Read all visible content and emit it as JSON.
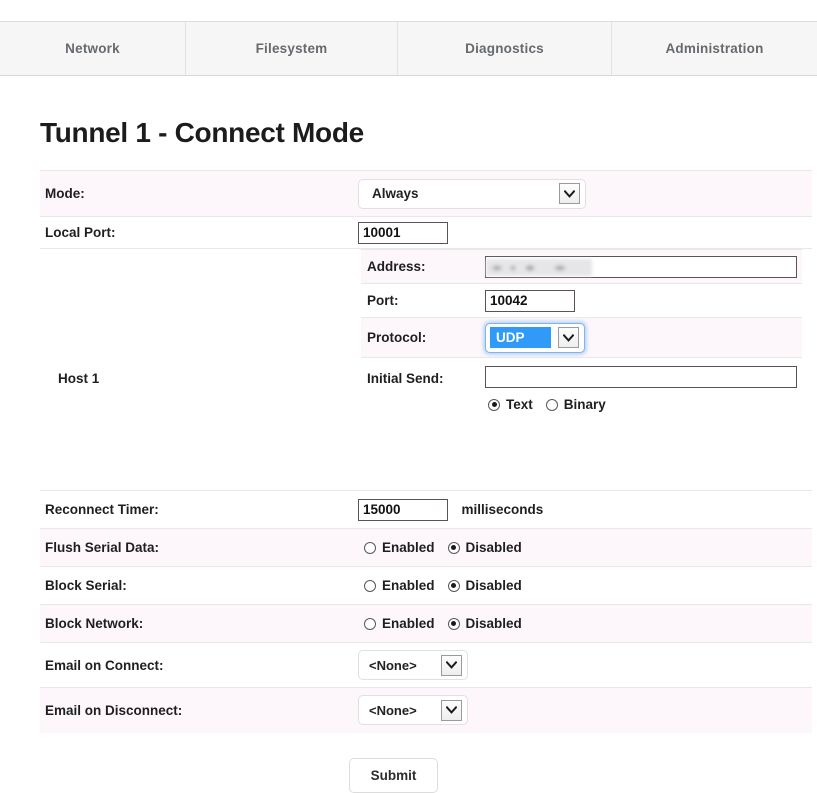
{
  "nav": {
    "tabs": [
      {
        "label": "Network"
      },
      {
        "label": "Filesystem"
      },
      {
        "label": "Diagnostics"
      },
      {
        "label": "Administration"
      }
    ]
  },
  "page": {
    "title": "Tunnel 1 - Connect Mode"
  },
  "form": {
    "mode": {
      "label": "Mode:",
      "value": "Always"
    },
    "local_port": {
      "label": "Local Port:",
      "value": "10001"
    },
    "host": {
      "label": "Host 1",
      "address": {
        "label": "Address:",
        "value": "",
        "redacted": true
      },
      "port": {
        "label": "Port:",
        "value": "10042"
      },
      "protocol": {
        "label": "Protocol:",
        "value": "UDP",
        "focused": true,
        "highlight_color": "#2f9af7",
        "focus_ring_color": "#7fb4e8"
      },
      "initial_send": {
        "label": "Initial Send:",
        "value": "",
        "options": [
          {
            "label": "Text",
            "selected": true
          },
          {
            "label": "Binary",
            "selected": false
          }
        ]
      }
    },
    "reconnect_timer": {
      "label": "Reconnect Timer:",
      "value": "15000",
      "units": "milliseconds"
    },
    "flush_serial_data": {
      "label": "Flush Serial Data:",
      "options": [
        {
          "label": "Enabled",
          "selected": false
        },
        {
          "label": "Disabled",
          "selected": true
        }
      ]
    },
    "block_serial": {
      "label": "Block Serial:",
      "options": [
        {
          "label": "Enabled",
          "selected": false
        },
        {
          "label": "Disabled",
          "selected": true
        }
      ]
    },
    "block_network": {
      "label": "Block Network:",
      "options": [
        {
          "label": "Enabled",
          "selected": false
        },
        {
          "label": "Disabled",
          "selected": true
        }
      ]
    },
    "email_on_connect": {
      "label": "Email on Connect:",
      "value": "<None>"
    },
    "email_on_disconnect": {
      "label": "Email on Disconnect:",
      "value": "<None>"
    },
    "submit": {
      "label": "Submit"
    }
  },
  "icons": {
    "chevron_down": "chevron-down-icon"
  }
}
